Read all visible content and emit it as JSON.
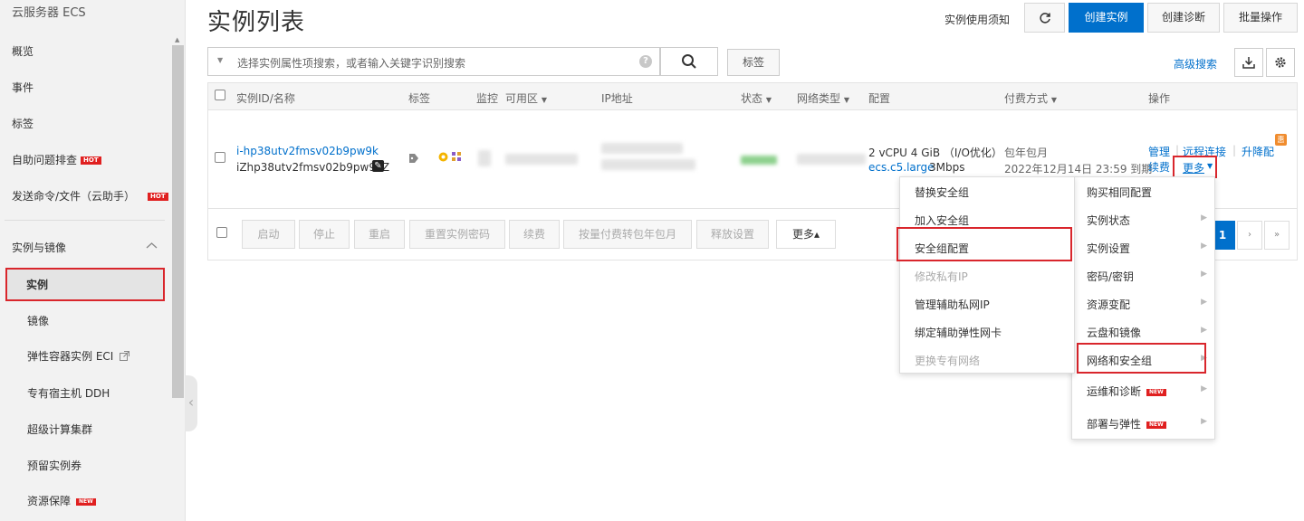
{
  "sidebar": {
    "title": "云服务器 ECS",
    "items": [
      {
        "label": "概览"
      },
      {
        "label": "事件"
      },
      {
        "label": "标签"
      },
      {
        "label": "自助问题排查",
        "badge": "HOT"
      },
      {
        "label": "发送命令/文件（云助手）",
        "badge": "HOT"
      }
    ],
    "group": {
      "label": "实例与镜像"
    },
    "sub_items": [
      {
        "label": "实例"
      },
      {
        "label": "镜像"
      },
      {
        "label": "弹性容器实例 ECI"
      },
      {
        "label": "专有宿主机 DDH"
      },
      {
        "label": "超级计算集群"
      },
      {
        "label": "预留实例券"
      },
      {
        "label": "资源保障",
        "badge": "NEW"
      }
    ]
  },
  "header": {
    "title": "实例列表",
    "notice_link": "实例使用须知",
    "create_btn": "创建实例",
    "diag_btn": "创建诊断",
    "batch_btn": "批量操作"
  },
  "search": {
    "placeholder": "选择实例属性项搜索，或者输入关键字识别搜索",
    "tag_btn": "标签",
    "advanced": "高级搜索"
  },
  "table": {
    "columns": [
      "实例ID/名称",
      "标签",
      "监控",
      "可用区",
      "IP地址",
      "状态",
      "网络类型",
      "配置",
      "付费方式",
      "操作"
    ],
    "row": {
      "id": "i-hp38utv2fmsv02b9pw9k",
      "name": "iZhp38utv2fmsv02b9pw9kZ",
      "config": "2 vCPU 4 GiB （I/O优化）",
      "instance_type": "ecs.c5.large",
      "bandwidth": "3Mbps",
      "billing": "包年包月",
      "expire": "2022年12月14日 23:59 到期",
      "actions": {
        "manage": "管理",
        "remote": "远程连接",
        "upgrade": "升降配",
        "renew": "续费",
        "more": "更多",
        "badge": "惠"
      }
    },
    "footer_buttons": [
      "启动",
      "停止",
      "重启",
      "重置实例密码",
      "续费",
      "按量付费转包年包月",
      "释放设置",
      "更多▴"
    ],
    "pager": {
      "current": "1",
      "next": "›",
      "last": "»"
    }
  },
  "more_menu": {
    "items": [
      {
        "label": "购买相同配置",
        "submenu": false
      },
      {
        "label": "实例状态",
        "submenu": true
      },
      {
        "label": "实例设置",
        "submenu": true
      },
      {
        "label": "密码/密钥",
        "submenu": true
      },
      {
        "label": "资源变配",
        "submenu": true
      },
      {
        "label": "云盘和镜像",
        "submenu": true
      },
      {
        "label": "网络和安全组",
        "submenu": true
      },
      {
        "label": "运维和诊断",
        "submenu": true,
        "badge": "NEW"
      },
      {
        "label": "部署与弹性",
        "submenu": true,
        "badge": "NEW"
      }
    ]
  },
  "sub_menu": {
    "items": [
      {
        "label": "替换安全组",
        "disabled": false
      },
      {
        "label": "加入安全组",
        "disabled": false
      },
      {
        "label": "安全组配置",
        "disabled": false
      },
      {
        "label": "修改私有IP",
        "disabled": true
      },
      {
        "label": "管理辅助私网IP",
        "disabled": false
      },
      {
        "label": "绑定辅助弹性网卡",
        "disabled": false
      },
      {
        "label": "更换专有网络",
        "disabled": true
      }
    ]
  },
  "colors": {
    "primary": "#0070cc",
    "highlight": "#d9262c",
    "hot": "#e02020"
  }
}
